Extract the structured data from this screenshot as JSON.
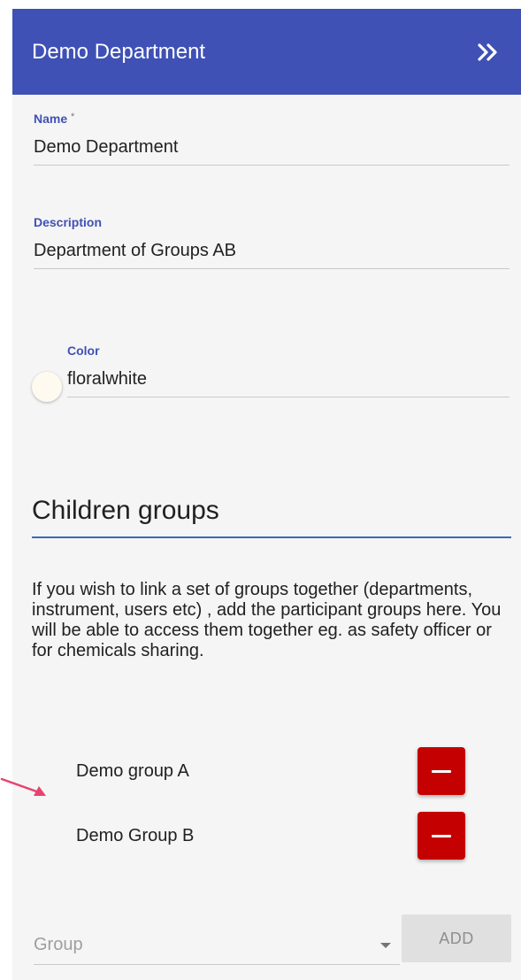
{
  "header": {
    "title": "Demo Department",
    "expand_icon": "double-chevron-right-icon",
    "background": "#3f51b5"
  },
  "form": {
    "name": {
      "label": "Name",
      "required_marker": "*",
      "value": "Demo Department"
    },
    "description": {
      "label": "Description",
      "value": "Department of Groups AB"
    },
    "color": {
      "label": "Color",
      "value": "floralwhite",
      "swatch_hex": "#fffaf0"
    }
  },
  "children_groups": {
    "title": "Children groups",
    "help_text": "If you wish to link a set of groups together (departments, instrument, users etc) , add the participant groups here. You will be able to access them together eg. as safety officer or for chemicals sharing.",
    "groups": [
      {
        "name": "Demo group A",
        "remove_icon": "minus-icon"
      },
      {
        "name": "Demo Group B",
        "remove_icon": "minus-icon"
      }
    ],
    "add_form": {
      "select_placeholder": "Group",
      "add_label": "ADD"
    }
  },
  "colors": {
    "accent": "#3f51b5",
    "danger": "#c50000",
    "annotation_arrow": "#e8436e"
  }
}
